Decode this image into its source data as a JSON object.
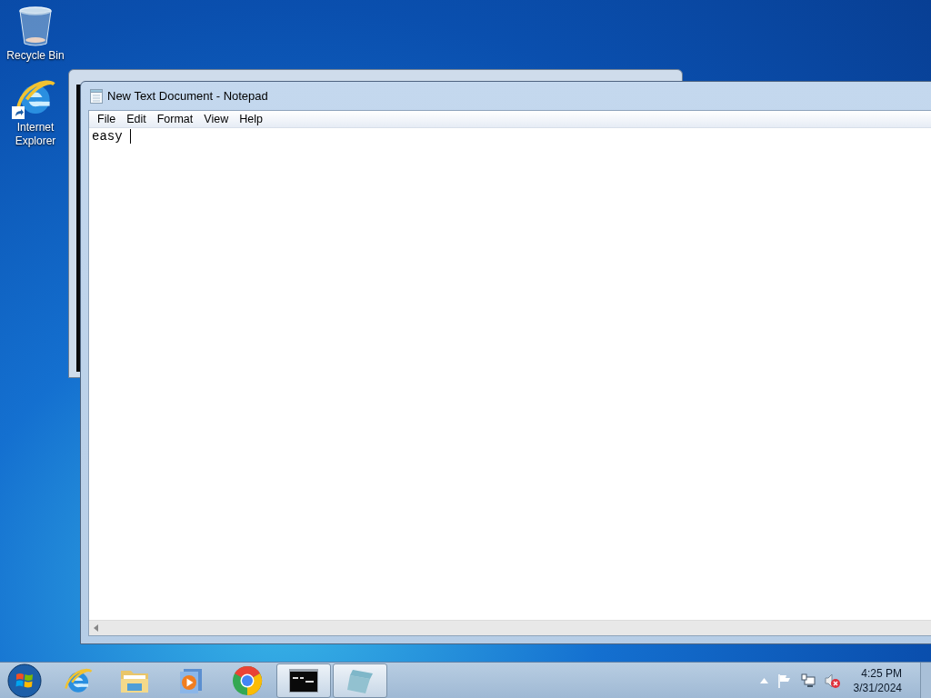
{
  "desktop_icons": [
    {
      "kind": "recycle",
      "label": "Recycle Bin"
    },
    {
      "kind": "ie",
      "label": "Internet Explorer"
    }
  ],
  "notepad": {
    "title": "New Text Document - Notepad",
    "menu": [
      "File",
      "Edit",
      "Format",
      "View",
      "Help"
    ],
    "text": "easy "
  },
  "taskbar": {
    "items": [
      {
        "kind": "ie",
        "open": false
      },
      {
        "kind": "folder",
        "open": false
      },
      {
        "kind": "media",
        "open": false
      },
      {
        "kind": "chrome",
        "open": false
      },
      {
        "kind": "cmd",
        "open": true
      },
      {
        "kind": "notepad",
        "open": true
      }
    ],
    "clock": {
      "time": "4:25 PM",
      "date": "3/31/2024"
    }
  }
}
